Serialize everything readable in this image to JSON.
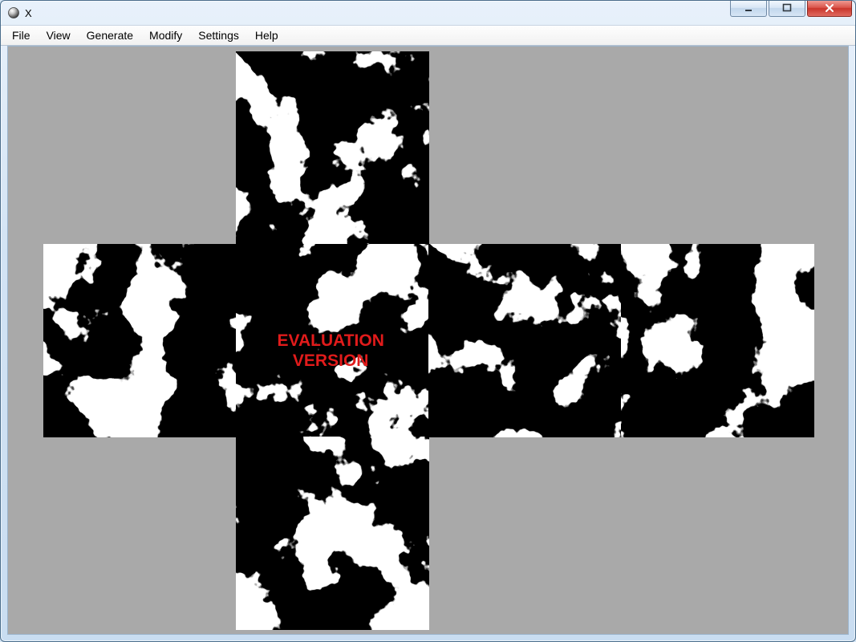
{
  "window": {
    "title": "X",
    "icon_name": "sphere-icon"
  },
  "menubar": {
    "items": [
      "File",
      "View",
      "Generate",
      "Modify",
      "Settings",
      "Help"
    ]
  },
  "canvas": {
    "watermark_line1": "EVALUATION",
    "watermark_line2": "VERSION",
    "watermark_color": "#e11b1b",
    "background_gray": "#a9a9a9"
  }
}
